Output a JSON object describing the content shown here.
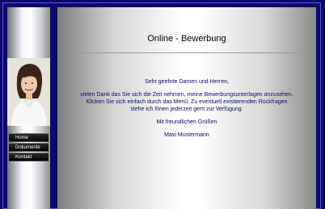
{
  "page": {
    "title": "Online - Bewerbung"
  },
  "nav": {
    "items": [
      {
        "label": "Home"
      },
      {
        "label": "Dokumente"
      },
      {
        "label": "Kontakt"
      }
    ]
  },
  "letter": {
    "salutation": "Sehr geehrte Damen und Herren,",
    "body_line1": "vielen Dank das Sie sich die Zeit nehmen, meine Bewerbungsunterlagen anzusehen.",
    "body_line2": "Klicken Sie sich einfach durch das Menü. Zu eventuell existierenden Rückfragen",
    "body_line3": "stehe ich Ihnen jederzeit gern zur Verfügung.",
    "closing": "Mit freundlichen Grüßen",
    "signature": "Maxi Mustermann"
  },
  "colors": {
    "frame": "#0a0a6e",
    "text": "#0b0b6a",
    "nav_bg": "#050505"
  }
}
